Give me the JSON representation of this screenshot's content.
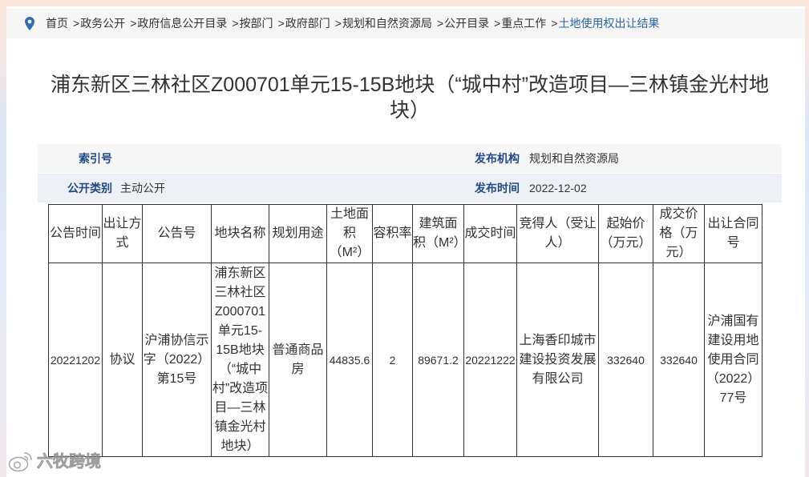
{
  "breadcrumb": {
    "icon": "location-pin-icon",
    "separator": ">",
    "items": [
      "首页",
      "政务公开",
      "政府信息公开目录",
      "按部门",
      "政府部门",
      "规划和自然资源局",
      "公开目录",
      "重点工作",
      "土地使用权出让结果"
    ]
  },
  "article": {
    "title": "浦东新区三林社区Z000701单元15-15B地块（“城中村”改造项目—三林镇金光村地块）"
  },
  "meta": {
    "index_no": {
      "label": "索引号"
    },
    "publisher": {
      "label": "发布机构",
      "value": "规划和自然资源局"
    },
    "category": {
      "label": "公开类别",
      "value": "主动公开"
    },
    "publish_date": {
      "label": "发布时间",
      "value": "2022-12-02"
    }
  },
  "land_table": {
    "headers": [
      "公告时间",
      "出让方式",
      "公告号",
      "地块名称",
      "规划用途",
      "土地面积（M²）",
      "容积率",
      "建筑面积（M²）",
      "成交时间",
      "竞得人（受让人）",
      "起始价（万元）",
      "成交价格（万元）",
      "出让合同号"
    ],
    "rows": [
      [
        "20221202",
        "协议",
        "沪浦协信示字（2022）第15号",
        "浦东新区三林社区Z000701单元15-15B地块（“城中村”改造项目—三林镇金光村地块）",
        "普通商品房",
        "44835.6",
        "2",
        "89671.2",
        "20221222",
        "上海香印城市建设投资发展有限公司",
        "332640",
        "332640",
        "沪浦国有建设用地使用合同（2022）77号"
      ]
    ]
  },
  "watermark": {
    "text": "六牧跨境",
    "icon": "weibo-logo-icon"
  },
  "colors": {
    "breadcrumb_active": "#2c64ad",
    "meta_label": "#234a86",
    "table_border": "#333333",
    "pin": "#2f6db5"
  }
}
